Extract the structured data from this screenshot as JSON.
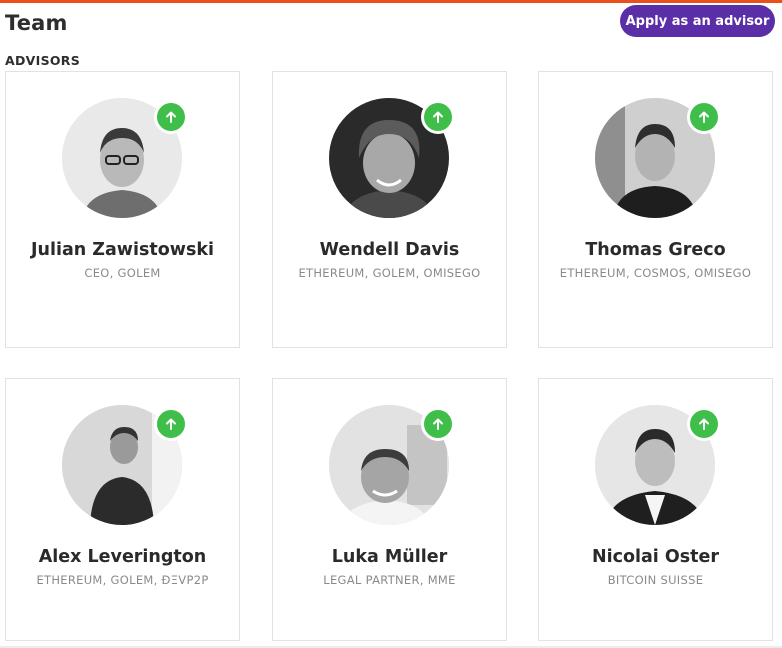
{
  "page": {
    "title": "Team"
  },
  "actions": {
    "apply_label": "Apply as an advisor"
  },
  "section": {
    "label": "ADVISORS"
  },
  "colors": {
    "accent": "#e8501e",
    "button": "#5a2ea6",
    "upvote": "#3fbf4a"
  },
  "advisors": [
    {
      "name": "Julian Zawistowski",
      "role": "CEO, GOLEM",
      "avatar_icon": "person-photo",
      "badge_icon": "arrow-up-icon"
    },
    {
      "name": "Wendell Davis",
      "role": "ETHEREUM, GOLEM, OMISEGO",
      "avatar_icon": "person-photo",
      "badge_icon": "arrow-up-icon"
    },
    {
      "name": "Thomas Greco",
      "role": "ETHEREUM, COSMOS, OMISEGO",
      "avatar_icon": "person-photo",
      "badge_icon": "arrow-up-icon"
    },
    {
      "name": "Alex Leverington",
      "role": "ETHEREUM, GOLEM, ÐΞVP2P",
      "avatar_icon": "person-photo",
      "badge_icon": "arrow-up-icon"
    },
    {
      "name": "Luka Müller",
      "role": "LEGAL PARTNER, MME",
      "avatar_icon": "person-photo",
      "badge_icon": "arrow-up-icon"
    },
    {
      "name": "Nicolai Oster",
      "role": "BITCOIN SUISSE",
      "avatar_icon": "person-photo",
      "badge_icon": "arrow-up-icon"
    }
  ]
}
